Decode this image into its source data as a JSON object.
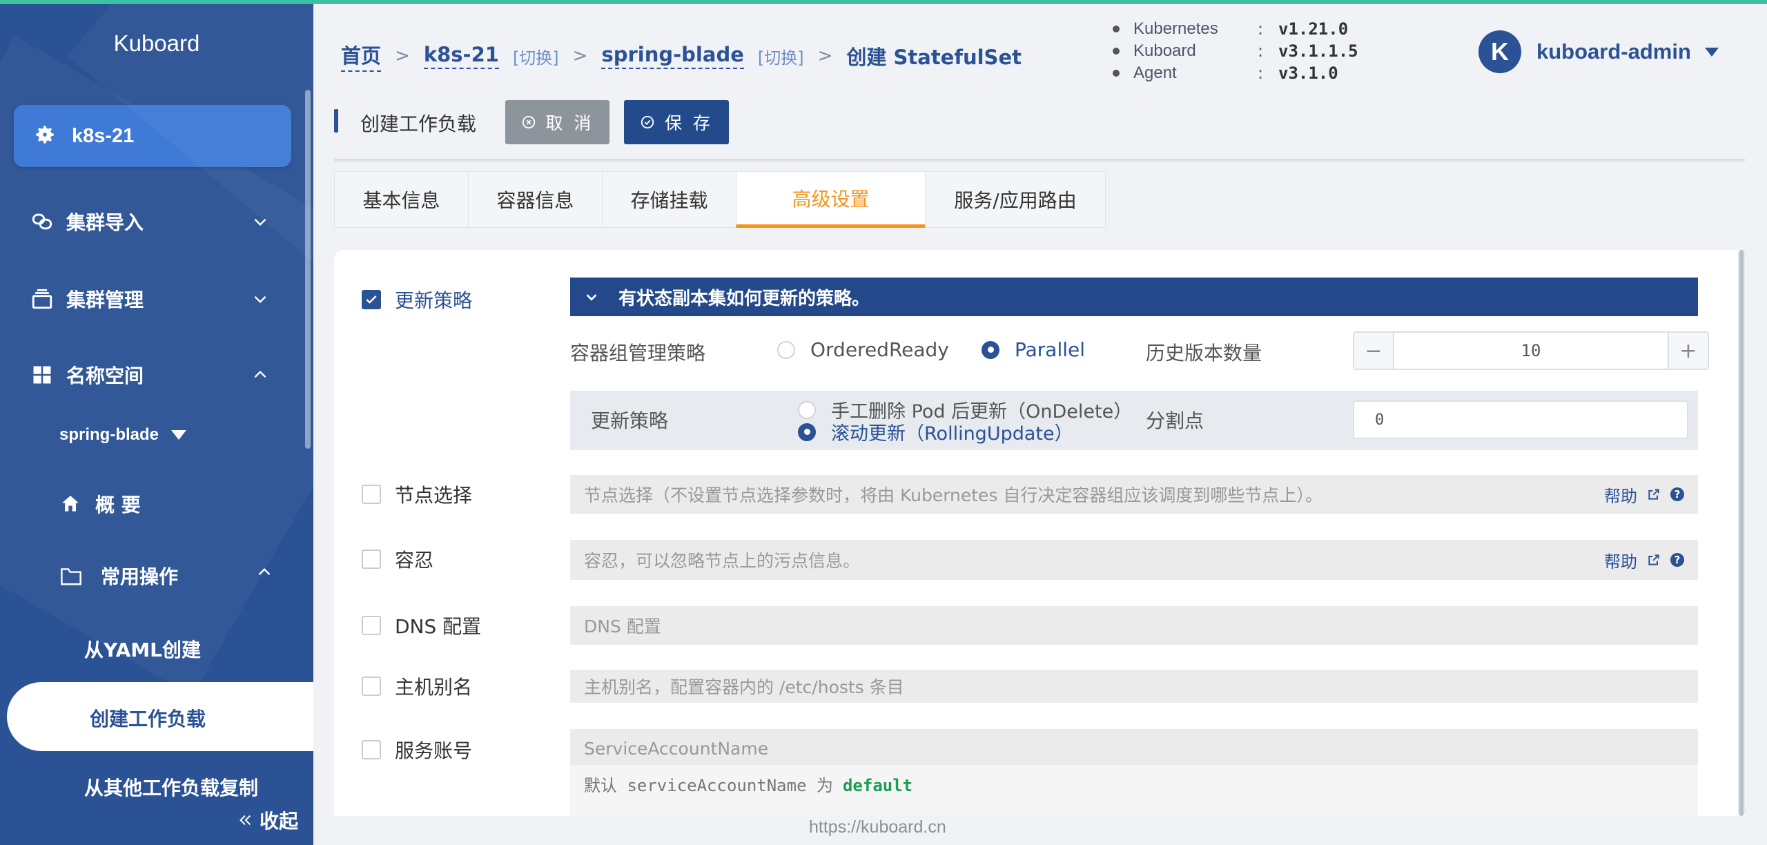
{
  "sidebar": {
    "brand": "Kuboard",
    "cluster": "k8s-21",
    "menu": [
      {
        "label": "集群导入",
        "icon": "link-icon",
        "expanded": false
      },
      {
        "label": "集群管理",
        "icon": "layers-icon",
        "expanded": false
      },
      {
        "label": "名称空间",
        "icon": "grid-icon",
        "expanded": true
      }
    ],
    "namespace": "spring-blade",
    "overview": "概 要",
    "common_ops": "常用操作",
    "from_yaml": "从YAML创建",
    "create_workload": "创建工作负载",
    "copy_workload": "从其他工作负载复制",
    "collapse": "收起"
  },
  "breadcrumb": {
    "home": "首页",
    "cluster": "k8s-21",
    "cluster_switch": "[切换]",
    "namespace": "spring-blade",
    "namespace_switch": "[切换]",
    "current": "创建 StatefulSet"
  },
  "versions": [
    {
      "name": "Kubernetes",
      "value": "v1.21.0"
    },
    {
      "name": "Kuboard",
      "value": "v3.1.1.5"
    },
    {
      "name": "Agent",
      "value": "v3.1.0"
    }
  ],
  "user": {
    "initial": "K",
    "name": "kuboard-admin"
  },
  "toolbar": {
    "title": "创建工作负载",
    "cancel": "取 消",
    "save": "保 存"
  },
  "tabs": [
    "基本信息",
    "容器信息",
    "存储挂载",
    "高级设置",
    "服务/应用路由"
  ],
  "active_tab": "高级设置",
  "update_strategy": {
    "label": "更新策略",
    "checked": true,
    "header": "有状态副本集如何更新的策略。",
    "pod_mgmt_label": "容器组管理策略",
    "pod_mgmt_options": [
      "OrderedReady",
      "Parallel"
    ],
    "pod_mgmt_selected": "Parallel",
    "history_label": "历史版本数量",
    "history_value": "10",
    "strategy_label": "更新策略",
    "strategy_options": [
      "手工删除 Pod 后更新（OnDelete）",
      "滚动更新（RollingUpdate）"
    ],
    "strategy_selected": "滚动更新（RollingUpdate）",
    "partition_label": "分割点",
    "partition_value": "0"
  },
  "node_select": {
    "label": "节点选择",
    "placeholder": "节点选择（不设置节点选择参数时，将由 Kubernetes 自行决定容器组应该调度到哪些节点上）。",
    "help": "帮助"
  },
  "tolerations": {
    "label": "容忍",
    "placeholder": "容忍，可以忽略节点上的污点信息。",
    "help": "帮助"
  },
  "dns": {
    "label": "DNS 配置",
    "placeholder": "DNS 配置"
  },
  "host_alias": {
    "label": "主机别名",
    "placeholder": "主机别名，配置容器内的 /etc/hosts 条目"
  },
  "service_account": {
    "label": "服务账号",
    "placeholder": "ServiceAccountName",
    "default_prefix": "默认 serviceAccountName 为",
    "default_value": "default"
  },
  "footer": "https://kuboard.cn",
  "colors": {
    "primary": "#2a5294",
    "accent": "#f7941d",
    "top_line": "#3cc2a0"
  }
}
